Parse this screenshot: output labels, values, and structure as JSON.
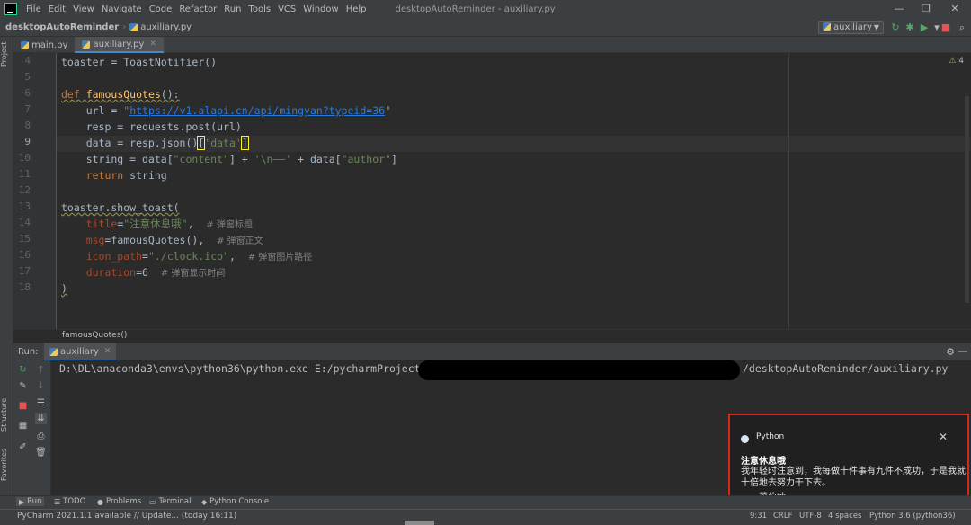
{
  "menu": {
    "items": [
      "File",
      "Edit",
      "View",
      "Navigate",
      "Code",
      "Refactor",
      "Run",
      "Tools",
      "VCS",
      "Window",
      "Help"
    ],
    "window_title": "desktopAutoReminder - auxiliary.py"
  },
  "navbar": {
    "project": "desktopAutoReminder",
    "file": "auxiliary.py",
    "run_config": "auxiliary"
  },
  "left_strip": {
    "project": "Project",
    "structure": "Structure",
    "favorites": "Favorites"
  },
  "tabs": [
    {
      "label": "main.py"
    },
    {
      "label": "auxiliary.py"
    }
  ],
  "editor": {
    "line_numbers": [
      "4",
      "5",
      "6",
      "7",
      "8",
      "9",
      "10",
      "11",
      "12",
      "13",
      "14",
      "15",
      "16",
      "17",
      "18"
    ],
    "current_line": "9",
    "warning_count": "4",
    "lines": {
      "l4": "toaster = ToastNotifier()",
      "l6_kw": "def ",
      "l6_fn": "famousQuotes",
      "l6_rest": "():",
      "l7_a": "    url = ",
      "l7_q1": "\"",
      "l7_url": "https://v1.alapi.cn/api/mingyan?typeid=36",
      "l7_q2": "\"",
      "l8": "    resp = requests.post(url)",
      "l9_a": "    data = resp.json()",
      "l9_b1": "[",
      "l9_str": "'data'",
      "l9_b2": "]",
      "l10_a": "    string = data[",
      "l10_s1": "\"content\"",
      "l10_b": "] + ",
      "l10_s2": "'\\n——'",
      "l10_c": " + data[",
      "l10_s3": "\"author\"",
      "l10_d": "]",
      "l11_kw": "    return",
      "l11_rest": " string",
      "l13": "toaster.show_toast(",
      "l14_p": "    title",
      "l14_eq": "=",
      "l14_s": "\"注意休息哦\"",
      "l14_c": ",  ",
      "l14_cmt": "# 弹窗标题",
      "l15_p": "    msg",
      "l15_rest": "=famousQuotes(),  ",
      "l15_cmt": "# 弹窗正文",
      "l16_p": "    icon_path",
      "l16_eq": "=",
      "l16_s": "\"./clock.ico\"",
      "l16_c": ",  ",
      "l16_cmt": "# 弹窗图片路径",
      "l17_p": "    duration",
      "l17_rest": "=6  ",
      "l17_cmt": "# 弹窗显示时间",
      "l18": ")"
    }
  },
  "breadcrumb": "famousQuotes()",
  "run_panel": {
    "label": "Run:",
    "tab": "auxiliary",
    "console_head": "D:\\DL\\anaconda3\\envs\\python36\\python.exe E:/pycharmProjects",
    "console_tail": "/desktopAutoReminder/auxiliary.py"
  },
  "toast": {
    "app": "Python",
    "title": "注意休息哦",
    "body": "我年轻时注意到，我每做十件事有九件不成功，于是我就十倍地去努力干下去。",
    "author": "——萧伯纳"
  },
  "bottom_tabs": [
    "Run",
    "TODO",
    "Problems",
    "Terminal",
    "Python Console"
  ],
  "status": {
    "message": "PyCharm 2021.1.1 available // Update... (today 16:11)",
    "position": "9:31",
    "line_sep": "CRLF",
    "encoding": "UTF-8",
    "indent": "4 spaces",
    "interpreter": "Python 3.6 (python36)"
  },
  "colors": {
    "highlight_border": "#d9261c",
    "accent": "#4a88c7"
  }
}
